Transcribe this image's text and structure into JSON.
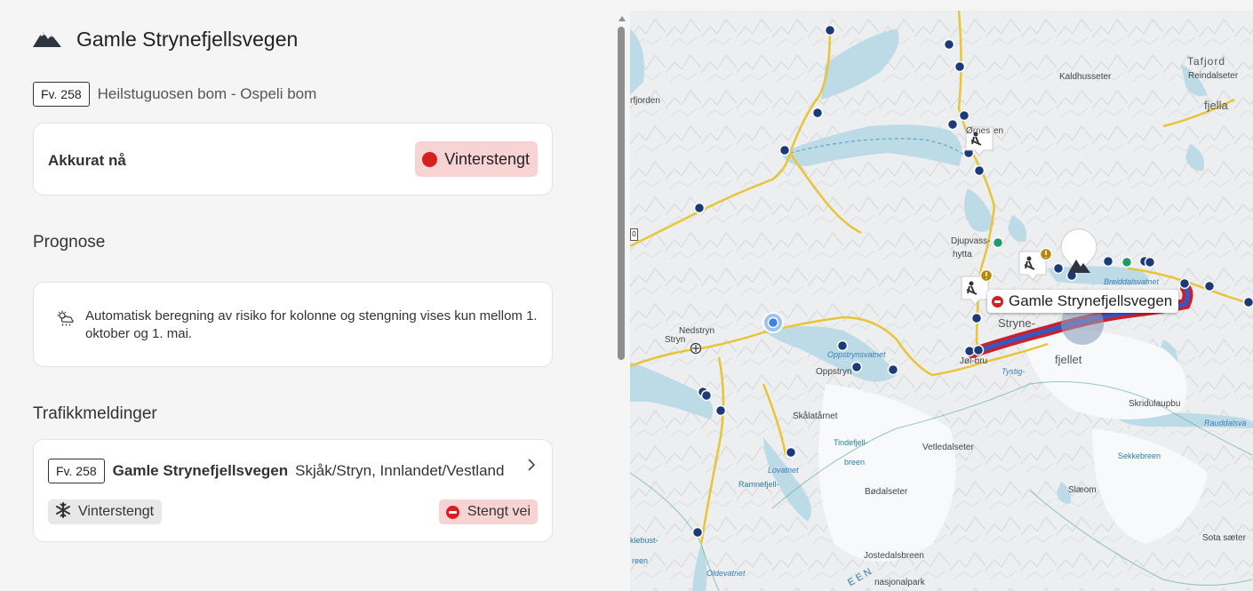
{
  "header": {
    "title": "Gamle Strynefjellsvegen",
    "icon": "mountain-icon"
  },
  "road": {
    "badge": "Fv. 258",
    "description": "Heilstuguosen bom - Ospeli bom"
  },
  "now": {
    "label": "Akkurat nå",
    "status": "Vinterstengt",
    "status_color": "#d81f1f"
  },
  "prognose": {
    "heading": "Prognose",
    "icon": "weather-icon",
    "text": "Automatisk beregning av risiko for kolonne og stengning vises kun mellom 1. oktober og 1. mai."
  },
  "traffic": {
    "heading": "Trafikkmeldinger",
    "item": {
      "badge": "Fv. 258",
      "name": "Gamle Strynefjellsvegen",
      "area": "Skjåk/Stryn, Innlandet/Vestland",
      "condition": "Vinterstengt",
      "condition_icon": "snowflake-icon",
      "closure": "Stengt vei"
    }
  },
  "map": {
    "callout": "Gamle Strynefjellsvegen",
    "edge_tag": "0",
    "labels": {
      "tafjord": "Tafjord",
      "reindalseter": "Reindalseter",
      "fjella": "fjella",
      "kaldhusseter": "Kaldhusseter",
      "rfjorden": "rfjorden",
      "ornes": "Ørnes",
      "ornes_suffix": "en",
      "djupvass": "Djupvass-",
      "hytta": "hytta",
      "breiddalsvatnet": "Breiddalsvatnet",
      "nedstryn": "Nedstryn",
      "stryn": "Stryn",
      "stryne": "Stryne-",
      "fjellet": "fjellet",
      "oppstrynsvatnet": "Oppstrynsvatnet",
      "oppstryn": "Oppstryn",
      "jolbru": "Jøl-bru",
      "tystig": "Tystig-",
      "skridulaupbu": "Skridulaupbu",
      "rauddalsvat": "Rauddalsva",
      "skalatarnet": "Skålatårnet",
      "tindefjell": "Tindefjell-",
      "breen": "breen",
      "vetledalseter": "Vetledalseter",
      "sekkebreen": "Sekkebreen",
      "lovatnet": "Lovatnet",
      "ramnefjell": "Ramnefjell-",
      "bodalseter": "Bødalseter",
      "slaeom": "Slæom",
      "klebust": "klebust-",
      "reen": "reen",
      "sota": "Sota sæter",
      "jostedalsbreen": "Jostedalsbreen",
      "nasjonalpark": "nasjonalpark",
      "oldevatnet": "Oldevatnet",
      "een": "EEN"
    }
  }
}
